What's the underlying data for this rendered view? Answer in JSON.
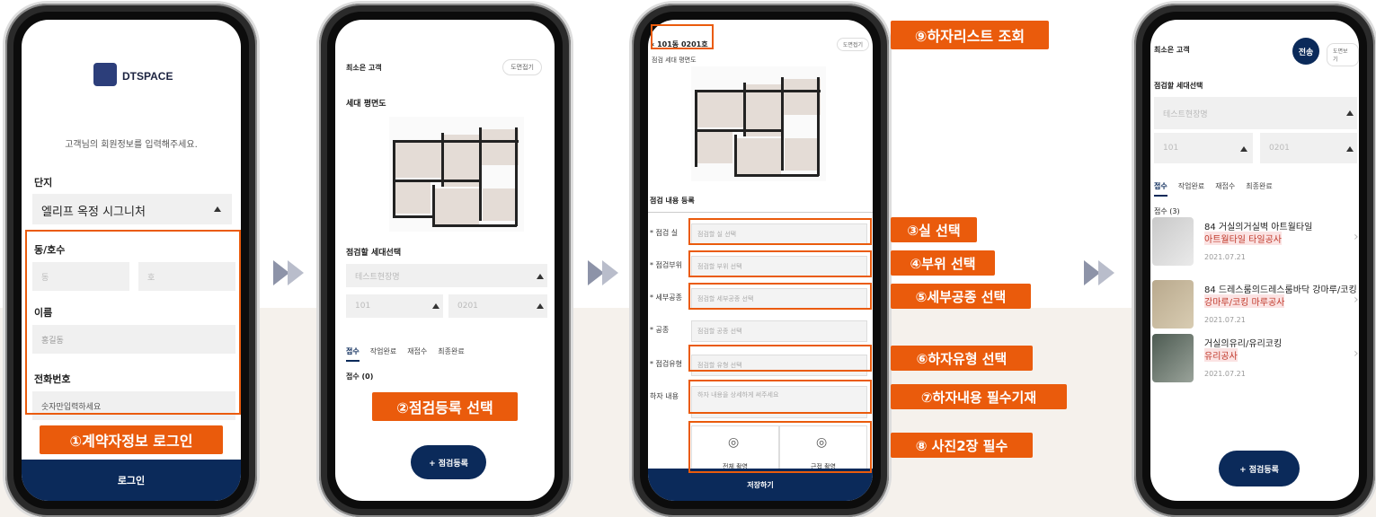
{
  "colors": {
    "accent": "#ea5b0c",
    "navy": "#0b2a5a"
  },
  "steps": {
    "s1": "①계약자정보 로그인",
    "s2": "②점검등록 선택",
    "s3": "③실 선택",
    "s4": "④부위 선택",
    "s5": "⑤세부공종 선택",
    "s6": "⑥하자유형 선택",
    "s7": "⑦하자내용 필수기재",
    "s8": "⑧ 사진2장 필수",
    "s9": "⑨하자리스트 조회"
  },
  "screen1": {
    "logo_text": "DTSPACE",
    "instruction": "고객님의 회원정보를 입력해주세요.",
    "complex_label": "단지",
    "complex_value": "엘리프 옥정 시그니처",
    "unit_label": "동/호수",
    "dong_placeholder": "동",
    "ho_placeholder": "호",
    "name_label": "이름",
    "name_placeholder": "홍길동",
    "phone_label": "전화번호",
    "phone_placeholder": "숫자만입력하세요",
    "login_button": "로그인"
  },
  "screen2": {
    "customer": "최소은 고객",
    "view_plan": "도면접기",
    "plan_title": "세대 평면도",
    "select_title": "점검할 세대선택",
    "site_placeholder": "테스트현장명",
    "dong": "101",
    "ho": "0201",
    "tabs": [
      "접수",
      "작업완료",
      "재접수",
      "최종완료"
    ],
    "count": "접수 (0)",
    "add_button": "+ 점검등록"
  },
  "screen3": {
    "back_title": "101동 0201호",
    "view_plan": "도면접기",
    "partial_title": "점검 세대 평면도",
    "section_title": "점검 내용 등록",
    "rows": [
      {
        "label": "* 점검 실",
        "placeholder": "점검할 실 선택"
      },
      {
        "label": "* 점검부위",
        "placeholder": "점검할 부위 선택"
      },
      {
        "label": "* 세부공종",
        "placeholder": "점검할 세부공종 선택"
      },
      {
        "label": "* 공종",
        "placeholder": "점검할 공종 선택"
      },
      {
        "label": "* 점검유형",
        "placeholder": "점검할 유형 선택"
      }
    ],
    "content_label": "하자 내용",
    "content_placeholder": "하자 내용을 상세하게 써주세요",
    "photo1": "전체 촬영",
    "photo2": "근접 촬영",
    "save_button": "저장하기"
  },
  "screen4": {
    "customer": "최소은 고객",
    "send_badge": "전송",
    "view_plan": "도면보기",
    "select_title": "점검할 세대선택",
    "site_placeholder": "테스트현장명",
    "dong": "101",
    "ho": "0201",
    "tabs": [
      "접수",
      "작업완료",
      "재접수",
      "최종완료"
    ],
    "count": "접수 (3)",
    "items": [
      {
        "title": "84 거실의거실벽 아트월타일",
        "sub": "아트월타일 타일공사",
        "date": "2021.07.21"
      },
      {
        "title": "84 드레스룸의드레스룸바닥 강마루/코킹",
        "sub": "강마루/코킹 마루공사",
        "date": "2021.07.21"
      },
      {
        "title": "거실의유리/유리코킹",
        "sub": "유리공사",
        "date": "2021.07.21"
      }
    ],
    "add_button": "+ 점검등록"
  }
}
